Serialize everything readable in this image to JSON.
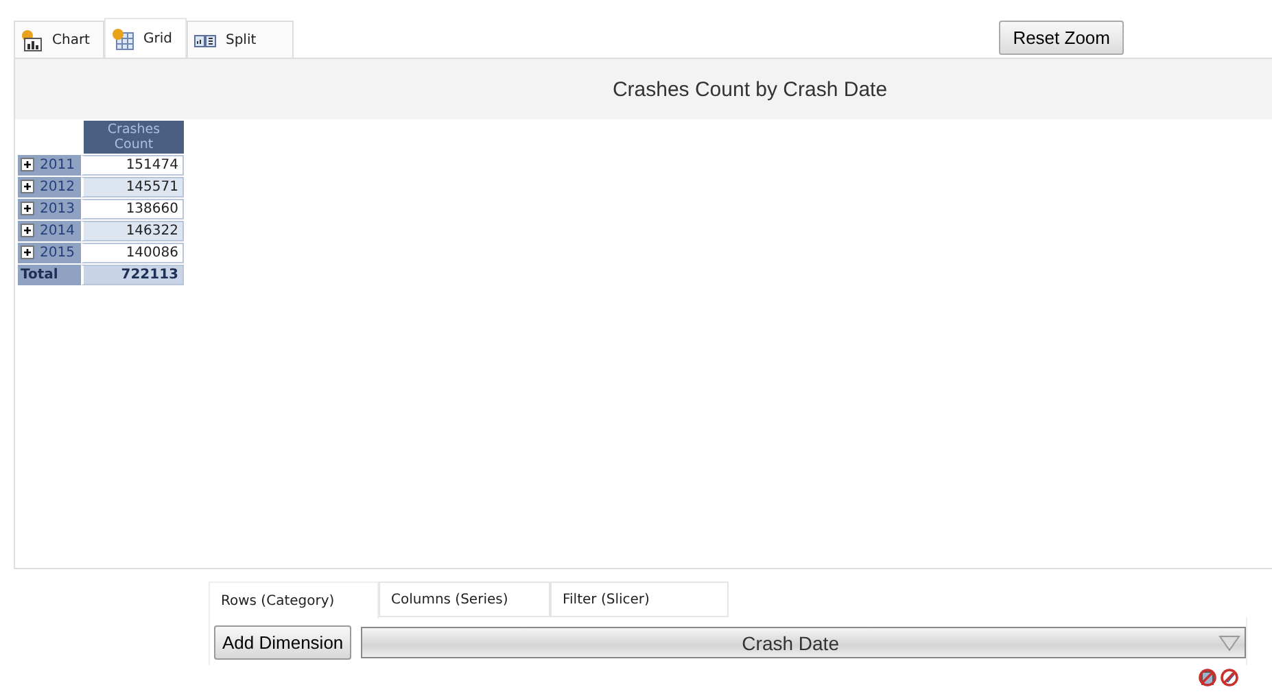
{
  "view_tabs": [
    {
      "label": "Chart",
      "kind": "chart",
      "selected": false
    },
    {
      "label": "Grid",
      "kind": "grid",
      "selected": true
    },
    {
      "label": "Split",
      "kind": "split",
      "selected": false
    }
  ],
  "reset_zoom_button": "Reset Zoom",
  "title": "Crashes Count by Crash Date",
  "grid": {
    "column_header": "Crashes Count",
    "rows": [
      {
        "label": "2011",
        "value": "151474",
        "expanded": false
      },
      {
        "label": "2012",
        "value": "145571",
        "expanded": false
      },
      {
        "label": "2013",
        "value": "138660",
        "expanded": false
      },
      {
        "label": "2014",
        "value": "146322",
        "expanded": false
      },
      {
        "label": "2015",
        "value": "140086",
        "expanded": false
      }
    ],
    "total": {
      "label": "Total",
      "value": "722113"
    }
  },
  "dimension_tabs": [
    {
      "label": "Rows (Category)",
      "selected": true
    },
    {
      "label": "Columns (Series)",
      "selected": false
    },
    {
      "label": "Filter (Slicer)",
      "selected": false
    }
  ],
  "add_dimension_button": "Add Dimension",
  "dimension_select": {
    "value": "Crash Date"
  }
}
